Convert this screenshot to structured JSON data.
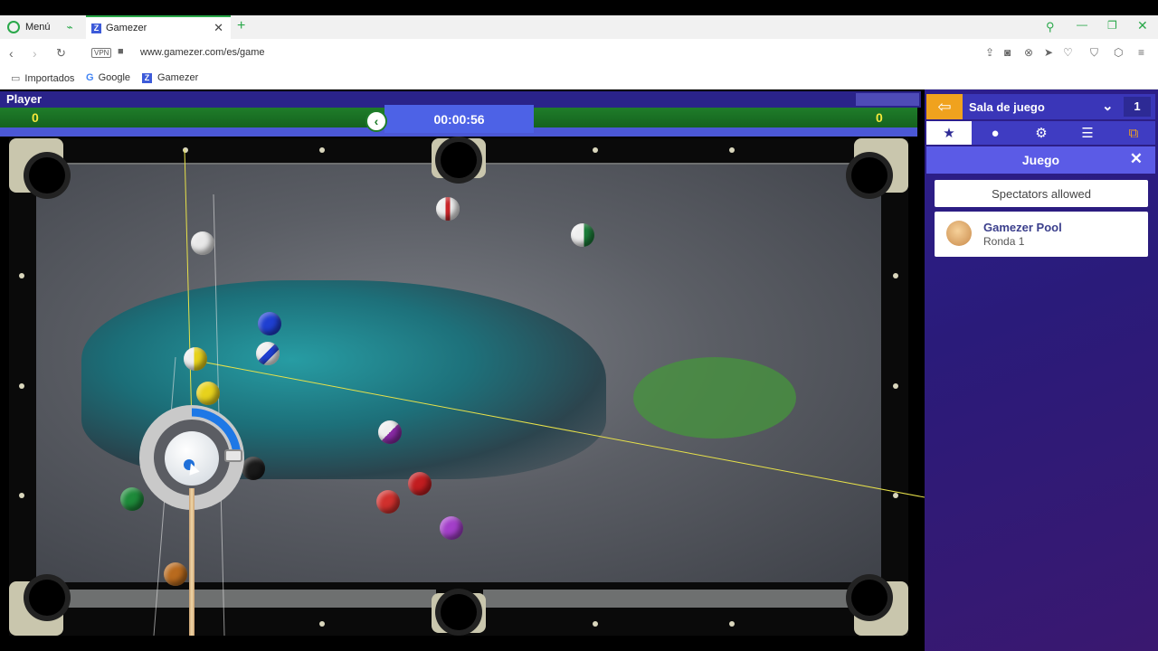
{
  "browser": {
    "tabs": [
      {
        "label": "Menú"
      },
      {
        "label": "Gamezer"
      }
    ],
    "url": "www.gamezer.com/es/game",
    "vpn_label": "VPN",
    "bookmarks": [
      {
        "label": "Importados"
      },
      {
        "label": "Google"
      },
      {
        "label": "Gamezer"
      }
    ],
    "accent_color": "#2aa84a"
  },
  "game": {
    "player_label": "Player",
    "score_left": "0",
    "score_right": "0",
    "timer": "00:00:56",
    "colors": {
      "score_bar": "#1f7d2a",
      "timer_bg": "#4d62e6",
      "felt": "#5b5e65"
    }
  },
  "panel": {
    "room_title": "Sala de juego",
    "room_number": "1",
    "section_title": "Juego",
    "spectators_text": "Spectators allowed",
    "game_name": "Gamezer Pool",
    "round_text": "Ronda 1",
    "tab_icons": [
      "star-icon",
      "user-icon",
      "gear-icon",
      "list-icon",
      "popout-icon"
    ],
    "colors": {
      "exit": "#f0a21e",
      "header": "#3a36b8",
      "section": "#5b5be6"
    }
  }
}
